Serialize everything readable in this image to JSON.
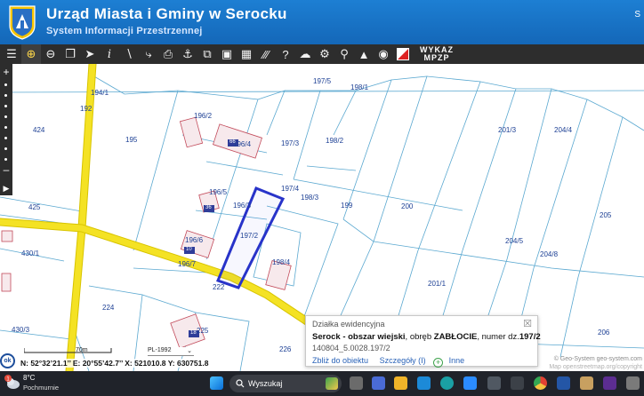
{
  "header": {
    "title": "Urząd Miasta i Gminy w Serocku",
    "subtitle": "System Informacji Przestrzennej",
    "right_label": "S"
  },
  "toolbar": {
    "mpzp_line1": "WYKAZ",
    "mpzp_line2": "MPZP",
    "icons": [
      "layers-icon",
      "zoom-in-icon",
      "zoom-out-icon",
      "zoom-extent-icon",
      "select-arrow-icon",
      "info-icon",
      "measure-line-icon",
      "lasso-icon",
      "print-icon",
      "anchor-icon",
      "export-icon",
      "layout-icon",
      "table-icon",
      "hatch-icon",
      "help-icon",
      "cloud-upload-icon",
      "settings-icon",
      "search-icon",
      "legend-icon",
      "locate-icon",
      "mpzp-flag-icon"
    ]
  },
  "map": {
    "parcels": [
      "197/5",
      "198/1",
      "194/1",
      "192",
      "196/2",
      "424",
      "195",
      "196/4",
      "197/3",
      "198/2",
      "201/3",
      "204/4",
      "197/4",
      "196/5",
      "198/3",
      "425",
      "196/3",
      "199",
      "200",
      "205",
      "197/2",
      "196/6",
      "204/5",
      "204/8",
      "430/1",
      "198/4",
      "196/7",
      "222",
      "201/1",
      "224",
      "226",
      "430/3",
      "225",
      "206"
    ],
    "buildings": [
      "10",
      "66",
      "36",
      "18",
      "3",
      "A"
    ],
    "highlighted_parcel": "197/2"
  },
  "popup": {
    "header": "Działka ewidencyjna",
    "place": "Serock - obszar wiejski",
    "obreb_label": ", obręb ",
    "obreb": "ZABŁOCIE",
    "numer_label": ", numer dz.",
    "numer": "197/2",
    "id": "140804_5.0028.197/2",
    "zoom_link": "Zbliż do obiektu",
    "details_link": "Szczegóły (I)",
    "more_link": "Inne"
  },
  "status": {
    "ok": "ok",
    "coords": "N: 52°32’21.1’’  E: 20°55’42.7’’  X: 521010.8  Y: 630751.8",
    "scale": "70m",
    "crs": "PL-1992",
    "attribution": "© Geo-System geo-system.com",
    "attribution2": "Map openstreetmap.org/copyright"
  },
  "taskbar": {
    "temp": "8°C",
    "weather": "Pochmurnie",
    "weather_badge": "1",
    "search_label": "Wyszukaj",
    "colors": {
      "background": "#20232a",
      "header": "#1c77c9"
    }
  }
}
